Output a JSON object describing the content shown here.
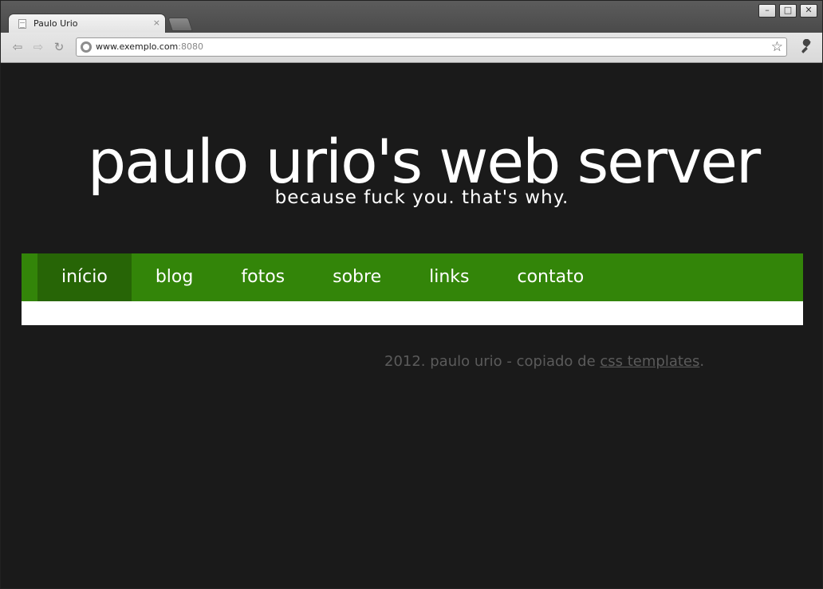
{
  "browser": {
    "tab_title": "Paulo Urio",
    "tab_close": "×",
    "url_host": "www.exemplo.com",
    "url_port": ":8080",
    "window_controls": {
      "minimize": "–",
      "maximize": "□",
      "close": "✕"
    },
    "nav": {
      "back": "⇦",
      "forward": "⇨",
      "reload": "↻"
    },
    "star": "☆",
    "wrench": "🔧"
  },
  "page": {
    "title": "paulo urio's web server",
    "tagline": "because fuck you. that's why.",
    "menu": [
      {
        "label": "início",
        "active": true
      },
      {
        "label": "blog",
        "active": false
      },
      {
        "label": "fotos",
        "active": false
      },
      {
        "label": "sobre",
        "active": false
      },
      {
        "label": "links",
        "active": false
      },
      {
        "label": "contato",
        "active": false
      }
    ],
    "footer": {
      "text": "2012. paulo urio - copiado de ",
      "link": "css templates",
      "end": "."
    }
  },
  "colors": {
    "background": "#1a1a1a",
    "menu_green": "#338509",
    "menu_active": "#276506"
  }
}
